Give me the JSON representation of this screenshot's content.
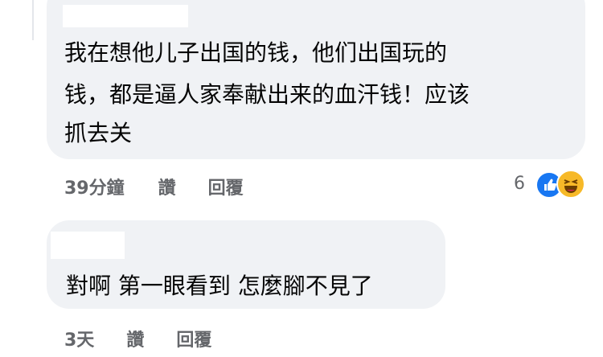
{
  "comments": [
    {
      "text_lines": [
        "我在想他儿子出国的钱，他们出国玩的",
        "钱，都是逼人家奉献出来的血汗钱！应该",
        "抓去关"
      ],
      "time": "39分鐘",
      "like_label": "讚",
      "reply_label": "回覆",
      "reaction_count": "6",
      "reactions": [
        "like-icon",
        "haha-icon"
      ]
    },
    {
      "text_lines": [
        "對啊 第一眼看到 怎麼腳不見了"
      ],
      "time": "3天",
      "like_label": "讚",
      "reply_label": "回覆"
    }
  ],
  "colors": {
    "bubble": "#f0f2f5",
    "meta_text": "#65676b",
    "like_blue": "#1877f2",
    "haha_yellow": "#f7b928"
  }
}
